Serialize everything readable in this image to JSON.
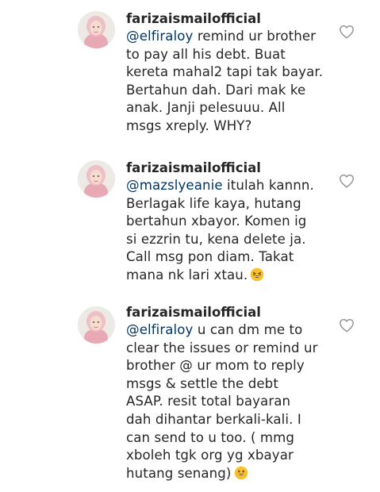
{
  "comments": [
    {
      "username": "farizaismailofficial",
      "mention": "@elfiraloy",
      "lines": [
        " remind ur brother",
        "to pay all his debt. Buat",
        "kereta mahal2 tapi tak bayar.",
        "Bertahun dah. Dari mak ke",
        "anak. Janji pelesuuu. All",
        "msgs xreply. WHY?"
      ],
      "like_icon": "heart-outline-icon"
    },
    {
      "username": "farizaismailofficial",
      "mention": "@mazslyeanie",
      "lines": [
        " itulah kannn.",
        "Berlagak life kaya, hutang",
        "bertahun xbayor. Komen ig",
        "si ezzrin tu, kena delete ja.",
        "Call msg pon diam. Takat",
        "mana nk lari xtau."
      ],
      "trailing_emoji": "grinning-squinting-face-emoji",
      "like_icon": "heart-outline-icon"
    },
    {
      "username": "farizaismailofficial",
      "mention": "@elfiraloy",
      "lines": [
        " u can dm me to",
        "clear the issues or remind ur",
        "brother @ ur mom to reply",
        "msgs & settle the debt",
        "ASAP.  resit total bayaran",
        "dah dihantar berkali-kali. I",
        "can send to u too. ( mmg",
        "xboleh tgk org yg xbayar",
        "hutang senang)"
      ],
      "trailing_emoji": "smiling-face-emoji",
      "like_icon": "heart-outline-icon"
    }
  ],
  "colors": {
    "username": "#262626",
    "body_text": "#262626",
    "mention": "#003569",
    "heart_outline": "#8e8e8e",
    "emoji_face": "#f7c02c"
  }
}
